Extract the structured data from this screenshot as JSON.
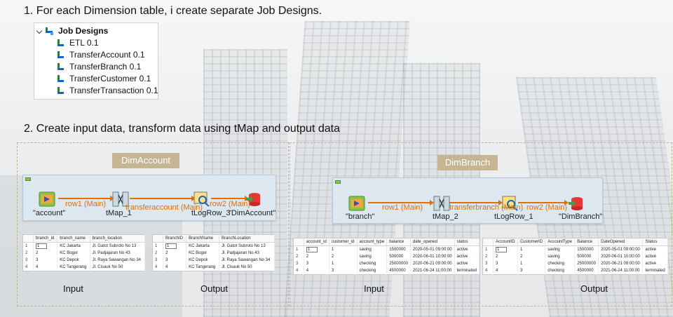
{
  "steps": {
    "step1": "1. For each Dimension table, i create separate Job Designs.",
    "step2": "2. Create input data, transform data using tMap and output data"
  },
  "repository": {
    "root": "Job Designs",
    "items": [
      "ETL 0.1",
      "TransferAccount 0.1",
      "TransferBranch 0.1",
      "TransferCustomer 0.1",
      "TransferTransaction 0.1"
    ]
  },
  "account_job": {
    "title": "DimAccount",
    "components": {
      "input": "\"account\"",
      "map": "tMap_1",
      "log": "tLogRow_3",
      "output": "\"DimAccount\""
    },
    "flows": [
      "row1 (Main)",
      "transferaccount (Main)",
      "row2 (Main)"
    ],
    "input_caption": "Input",
    "output_caption": "Output",
    "input_table": {
      "headers": [
        "",
        "branch_id",
        "branch_name",
        "branch_location"
      ],
      "rows": [
        [
          "1",
          "1",
          "KC Jakarta",
          "Jl. Gatot Subroto No 13"
        ],
        [
          "2",
          "2",
          "KC Bogor",
          "Jl. Padjajaran No 43"
        ],
        [
          "3",
          "3",
          "KC Depok",
          "Jl. Raya Sawangan No 34"
        ],
        [
          "4",
          "4",
          "KC Tangerang",
          "Jl. Cisauk No 50"
        ]
      ]
    },
    "output_table": {
      "headers": [
        "",
        "BranchID",
        "BranchName",
        "BranchLocation"
      ],
      "rows": [
        [
          "1",
          "1",
          "KC Jakarta",
          "Jl. Gatot Subroto No 13"
        ],
        [
          "2",
          "2",
          "KC Bogor",
          "Jl. Padjajaran No 43"
        ],
        [
          "3",
          "3",
          "KC Depok",
          "Jl. Raya Sawangan No 34"
        ],
        [
          "4",
          "4",
          "KC Tangerang",
          "Jl. Cisauk No 50"
        ]
      ]
    }
  },
  "branch_job": {
    "title": "DimBranch",
    "components": {
      "input": "\"branch\"",
      "map": "tMap_2",
      "log": "tLogRow_1",
      "output": "\"DimBranch\""
    },
    "flows": [
      "row1 (Main)",
      "transferbranch (Main)",
      "row2 (Main)"
    ],
    "input_caption": "Input",
    "output_caption": "Output",
    "input_table": {
      "headers": [
        "",
        "account_id",
        "customer_id",
        "account_type",
        "balance",
        "date_opened",
        "status"
      ],
      "rows": [
        [
          "1",
          "1",
          "1",
          "saving",
          "1500000",
          "2020-05-01 09:00:00",
          "active"
        ],
        [
          "2",
          "2",
          "2",
          "saving",
          "500000",
          "2020-06-01 10:00:00",
          "active"
        ],
        [
          "3",
          "3",
          "1",
          "checking",
          "25000000",
          "2020-06-21 09:00:00",
          "active"
        ],
        [
          "4",
          "4",
          "3",
          "checking",
          "4500000",
          "2021-06-24 11:00:00",
          "terminated"
        ]
      ]
    },
    "output_table": {
      "headers": [
        "",
        "AccountID",
        "CustomerID",
        "AccountType",
        "Balance",
        "DateOpened",
        "Status"
      ],
      "rows": [
        [
          "1",
          "1",
          "1",
          "saving",
          "1500000",
          "2020-05-01 09:00:00",
          "active"
        ],
        [
          "2",
          "2",
          "2",
          "saving",
          "500000",
          "2020-06-01 10:00:00",
          "active"
        ],
        [
          "3",
          "3",
          "1",
          "checking",
          "25000000",
          "2020-06-21 09:00:00",
          "active"
        ],
        [
          "4",
          "4",
          "3",
          "checking",
          "4500000",
          "2021-06-24 11:00:00",
          "terminated"
        ]
      ]
    }
  },
  "colors": {
    "flow": "#e07000",
    "chip": "#c5b593",
    "canvas": "#dce7f0"
  }
}
